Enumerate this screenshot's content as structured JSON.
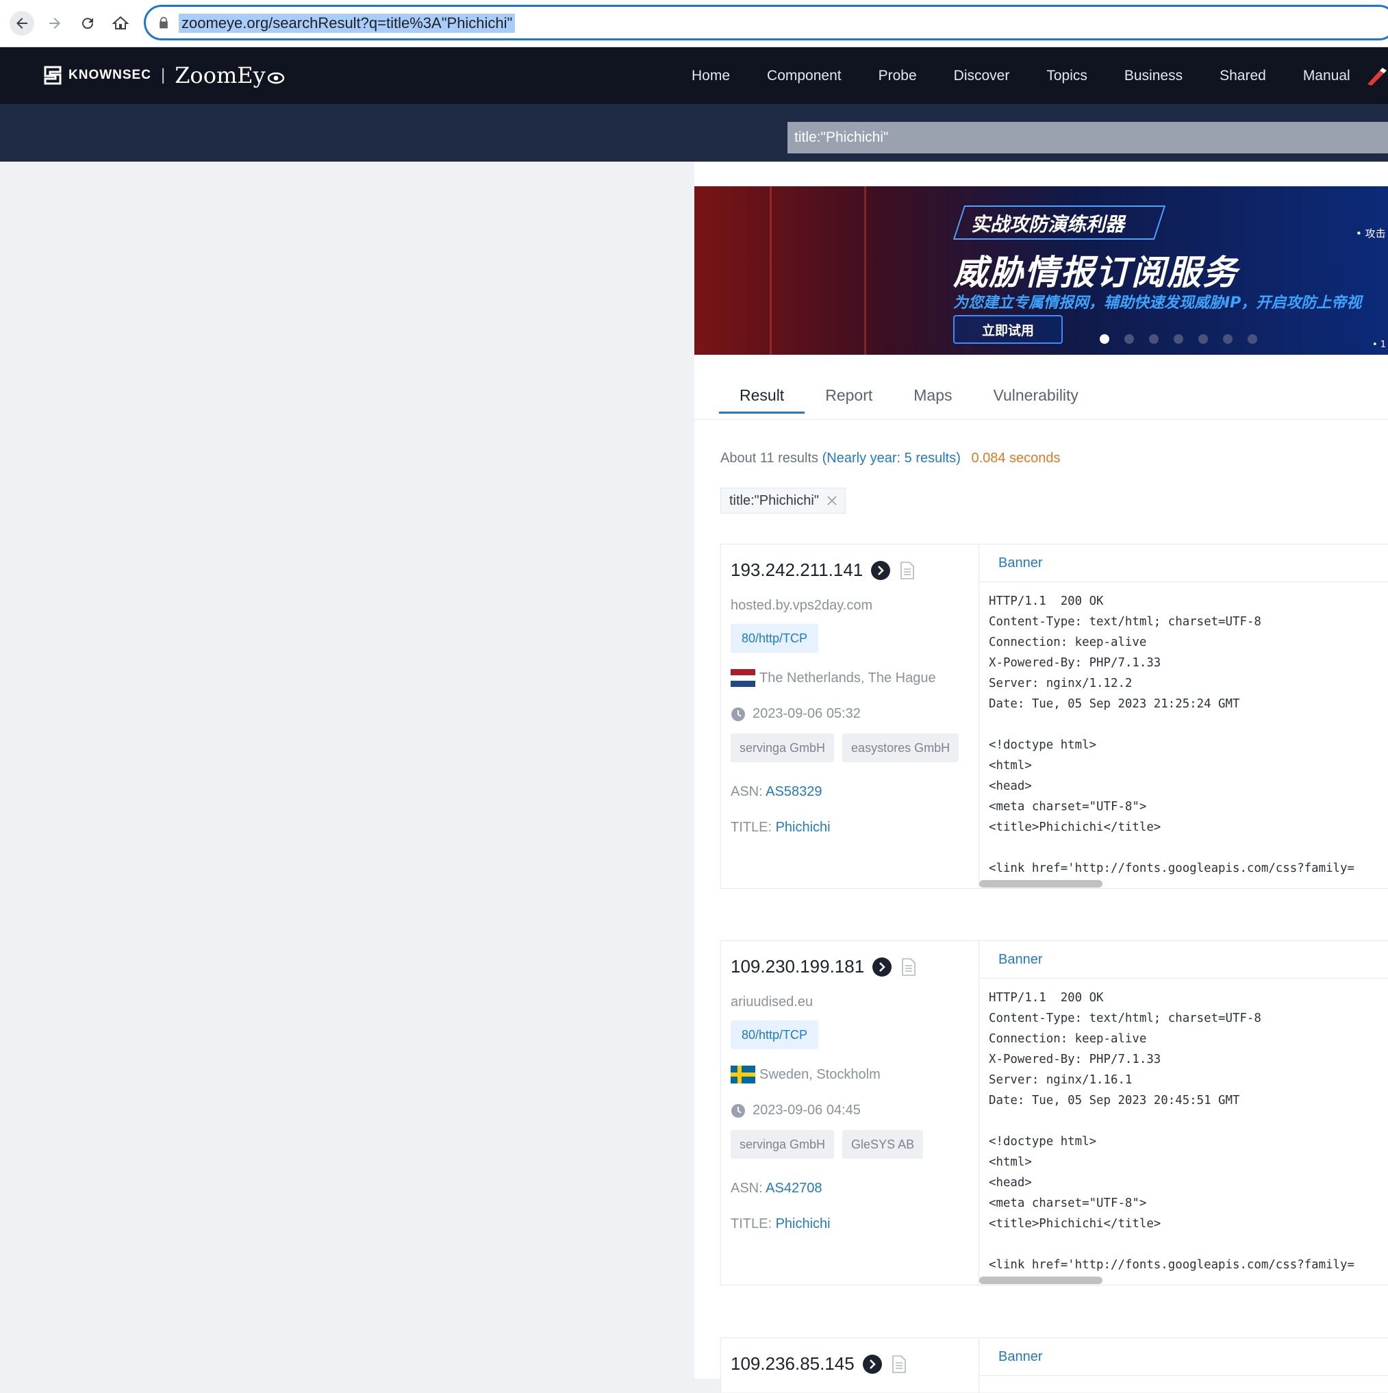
{
  "browser": {
    "url": "zoomeye.org/searchResult?q=title%3A\"Phichichi\""
  },
  "header": {
    "brand_left": "KNOWNSEC",
    "brand_separator": "|",
    "brand_right": "ZoomEy",
    "nav": [
      "Home",
      "Component",
      "Probe",
      "Discover",
      "Topics",
      "Business",
      "Shared",
      "Manual"
    ]
  },
  "search": {
    "query": "title:\"Phichichi\""
  },
  "promo": {
    "tag": "实战攻防演练利器",
    "title": "威胁情报订阅服务",
    "subtitle": "为您建立专属情报网，辅助快速发现威胁IP，开启攻防上帝视",
    "cta": "立即试用",
    "side_text": "• 攻击",
    "side_text_2": "• 1",
    "dots_total": 7,
    "active_dot": 1
  },
  "tabs": [
    "Result",
    "Report",
    "Maps",
    "Vulnerability"
  ],
  "summary": {
    "about": "About 11 results",
    "near": "(Nearly year: 5 results)",
    "seconds": "0.084 seconds"
  },
  "filter_chip": "title:\"Phichichi\"",
  "labels": {
    "asn": "ASN:",
    "title": "TITLE:",
    "banner": "Banner"
  },
  "results": [
    {
      "ip": "193.242.211.141",
      "host": "hosted.by.vps2day.com",
      "port": "80/http/TCP",
      "location": "The Netherlands, The Hague",
      "country": "netherlands",
      "time": "2023-09-06 05:32",
      "orgs": [
        "servinga GmbH",
        "easystores GmbH"
      ],
      "asn": "AS58329",
      "title": "Phichichi",
      "banner": "HTTP/1.1  200 OK\nContent-Type: text/html; charset=UTF-8\nConnection: keep-alive\nX-Powered-By: PHP/7.1.33\nServer: nginx/1.12.2\nDate: Tue, 05 Sep 2023 21:25:24 GMT\n\n<!doctype html>\n<html>\n<head>\n<meta charset=\"UTF-8\">\n<title>Phichichi</title>\n\n<link href='http://fonts.googleapis.com/css?family="
    },
    {
      "ip": "109.230.199.181",
      "host": "ariuudised.eu",
      "port": "80/http/TCP",
      "location": "Sweden, Stockholm",
      "country": "sweden",
      "time": "2023-09-06 04:45",
      "orgs": [
        "servinga GmbH",
        "GleSYS AB"
      ],
      "asn": "AS42708",
      "title": "Phichichi",
      "banner": "HTTP/1.1  200 OK\nContent-Type: text/html; charset=UTF-8\nConnection: keep-alive\nX-Powered-By: PHP/7.1.33\nServer: nginx/1.16.1\nDate: Tue, 05 Sep 2023 20:45:51 GMT\n\n<!doctype html>\n<html>\n<head>\n<meta charset=\"UTF-8\">\n<title>Phichichi</title>\n\n<link href='http://fonts.googleapis.com/css?family="
    },
    {
      "ip": "109.236.85.145"
    }
  ]
}
